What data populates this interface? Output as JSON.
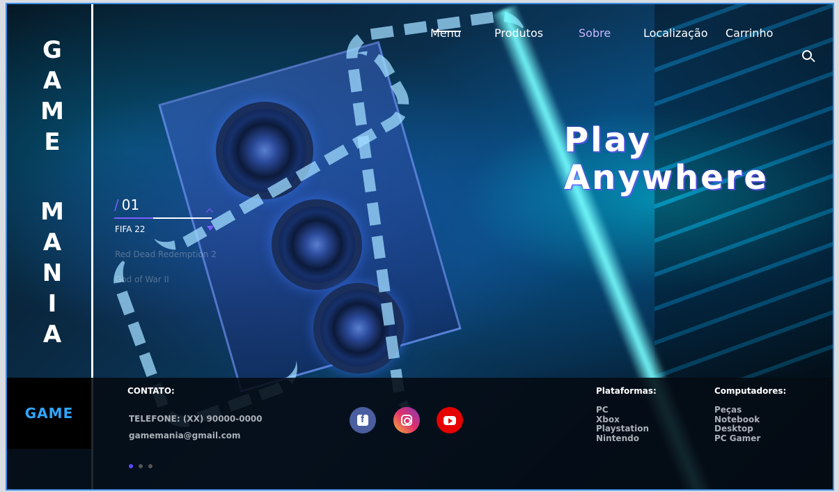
{
  "brand": {
    "letters": [
      "G",
      "A",
      "M",
      "E",
      "M",
      "A",
      "N",
      "I",
      "A"
    ],
    "logo_text": "GAME"
  },
  "nav": {
    "items": [
      "Menu",
      "Produtos",
      "Sobre",
      "Localização",
      "Carrinho"
    ]
  },
  "hero": {
    "line1": "Play",
    "line2": "Anywhere"
  },
  "slider": {
    "counter": "01",
    "games": [
      "FIFA 22",
      "Red Dead Redemption 2",
      "God of War II"
    ]
  },
  "footer": {
    "contact_title": "CONTATO:",
    "phone": "TELEFONE: (XX) 90000-0000",
    "email": "gamemania@gmail.com",
    "social": [
      "facebook-icon",
      "instagram-icon",
      "youtube-icon"
    ],
    "platforms": {
      "title": "Plataformas:",
      "items": [
        "PC",
        "Xbox",
        "Playstation",
        "Nintendo"
      ]
    },
    "computers": {
      "title": "Computadores:",
      "items": [
        "Peças",
        "Notebook",
        "Desktop",
        "PC Gamer"
      ]
    }
  },
  "colors": {
    "accent": "#7d5cff",
    "logo": "#2fa6ff",
    "frame": "#3d8ee6"
  }
}
